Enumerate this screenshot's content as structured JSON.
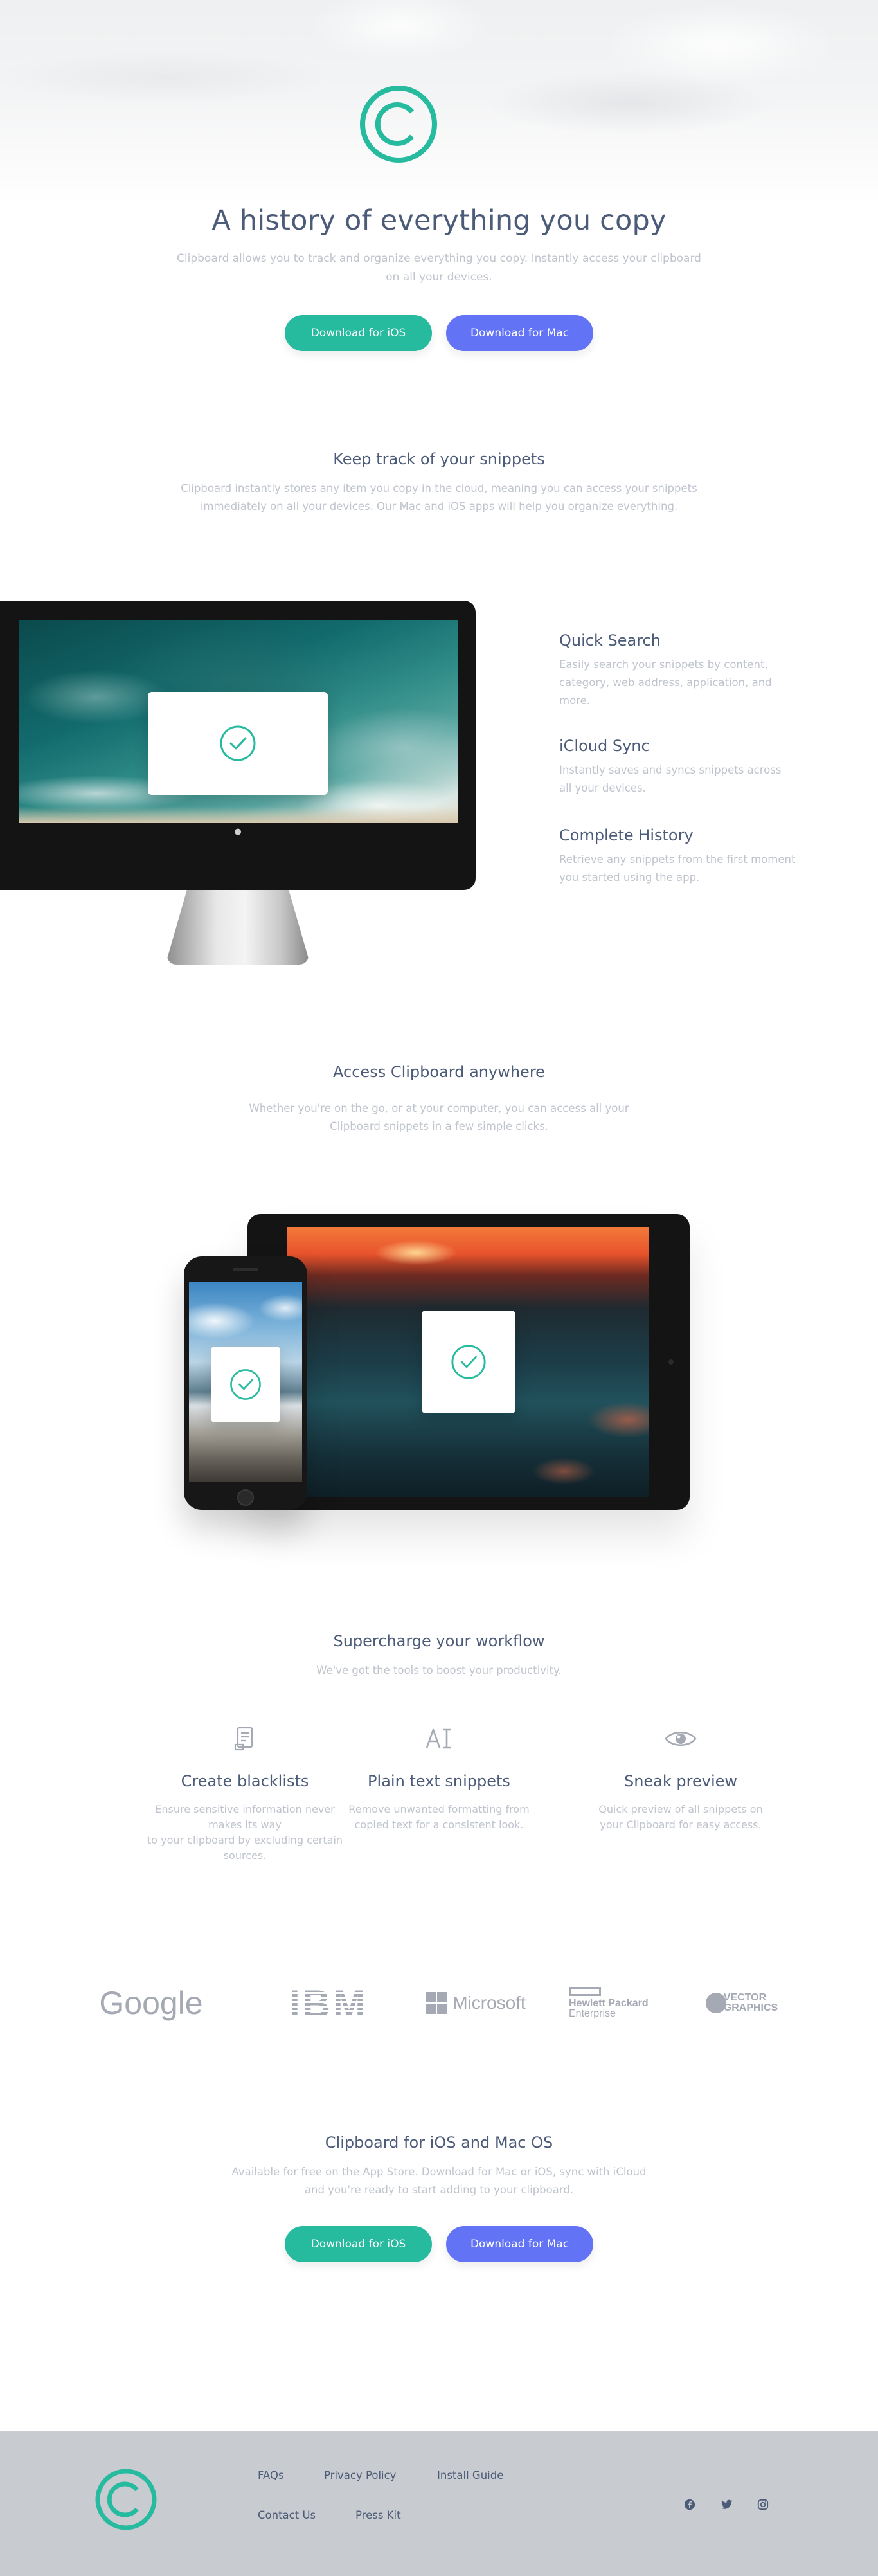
{
  "hero": {
    "title": "A history of everything you copy",
    "description_line1": "Clipboard allows you to track and organize everything you copy. Instantly access your clipboard",
    "description_line2": "on all your devices.",
    "btn_ios": "Download for iOS",
    "btn_mac": "Download for Mac"
  },
  "snippets": {
    "title": "Keep track of your snippets",
    "desc_line1": "Clipboard instantly stores any item you copy in the cloud, meaning you can access your snippets",
    "desc_line2": "immediately on all your devices. Our Mac and iOS apps will help you organize everything.",
    "features": [
      {
        "title": "Quick Search",
        "desc_line1": "Easily search your snippets by content,",
        "desc_line2": "category, web address, application, and",
        "desc_line3": "more."
      },
      {
        "title": "iCloud Sync",
        "desc_line1": "Instantly saves and syncs snippets across",
        "desc_line2": "all your devices."
      },
      {
        "title": "Complete History",
        "desc_line1": "Retrieve any snippets from the first moment",
        "desc_line2": "you started using the app."
      }
    ]
  },
  "access": {
    "title": "Access Clipboard anywhere",
    "desc_line1": "Whether you're on the go, or at your computer, you can access all your",
    "desc_line2": "Clipboard snippets in a few simple clicks."
  },
  "workflow": {
    "title": "Supercharge your workflow",
    "subtitle": "We've got the tools to boost your productivity.",
    "items": [
      {
        "icon": "blacklist-icon",
        "title": "Create blacklists",
        "desc_line1": "Ensure sensitive information never makes its way",
        "desc_line2": "to your clipboard by excluding certain sources."
      },
      {
        "icon": "text-icon",
        "title": "Plain text snippets",
        "desc_line1": "Remove unwanted formatting from",
        "desc_line2": "copied text for a consistent look."
      },
      {
        "icon": "eye-icon",
        "title": "Sneak preview",
        "desc_line1": "Quick preview of all snippets on",
        "desc_line2": "your Clipboard for easy access."
      }
    ]
  },
  "logos": {
    "google": "Google",
    "ibm": "IBM",
    "microsoft": "Microsoft",
    "hp_line1": "Hewlett Packard",
    "hp_line2": "Enterprise",
    "vector_line1": "VECTOR",
    "vector_line2": "GRAPHICS"
  },
  "cta": {
    "title": "Clipboard for iOS and Mac OS",
    "desc_line1": "Available for free on the App Store. Download for Mac or iOS, sync with iCloud",
    "desc_line2": "and you're ready to start adding to your clipboard.",
    "btn_ios": "Download for iOS",
    "btn_mac": "Download for Mac"
  },
  "footer": {
    "links": [
      "FAQs",
      "Privacy Policy",
      "Install Guide",
      "Contact Us",
      "Press Kit"
    ],
    "social": [
      "facebook-icon",
      "twitter-icon",
      "instagram-icon"
    ]
  },
  "colors": {
    "accent_green": "#26ba9f",
    "accent_blue": "#6373f6",
    "heading": "#4c5b78",
    "body_text": "#bfc4cd",
    "footer_bg": "#c8cbcf"
  }
}
